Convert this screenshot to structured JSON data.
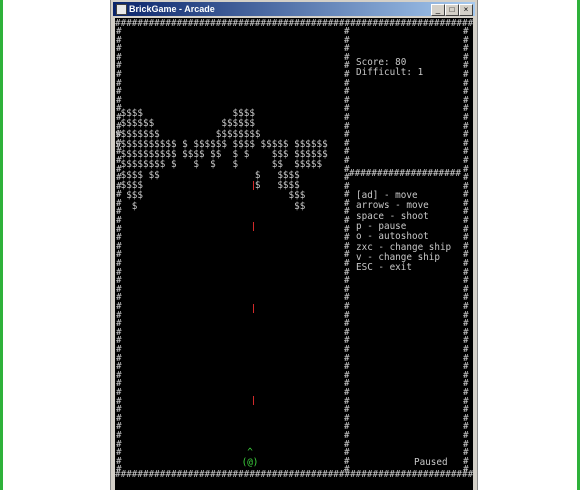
{
  "window": {
    "title": "BrickGame - Arcade",
    "min_glyph": "_",
    "max_glyph": "□",
    "close_glyph": "×"
  },
  "colors": {
    "background": "#000000",
    "text": "#c8c8c8",
    "ship": "#3fd83f",
    "bullet": "#d22a2a"
  },
  "sidebar": {
    "score": "Score: 80",
    "difficulty": "Difficult: 1",
    "help": [
      "[ad] - move",
      "arrows - move",
      "space - shoot",
      "p - pause",
      "o - autoshoot",
      "zxc - change ship",
      "v - change ship",
      "ESC - exit"
    ],
    "status": "Paused"
  },
  "game": {
    "bricks": [
      " $$$$                $$$$ ",
      " $$$$$$            $$$$$$ ",
      "$$$$$$$$          $$$$$$$$",
      "$$$$$$$$$$$ $ $$$$$$ $$$$ $$$$$ $$$$$$",
      " $$$$$$$$$$ $$$$ $$  $ $    $$$ $$$$$$",
      " $$$$$$$$ $   $  $   $      $$  $$$$$",
      " $$$$ $$                 $   $$$$",
      " $$$$                    $   $$$$",
      "  $$$                          $$$",
      "   $                            $$"
    ],
    "ship": {
      "top": "^",
      "body": "(@)"
    },
    "bullets": [
      {
        "row": 9
      },
      {
        "row": 13
      },
      {
        "row": 21
      },
      {
        "row": 30
      }
    ]
  }
}
